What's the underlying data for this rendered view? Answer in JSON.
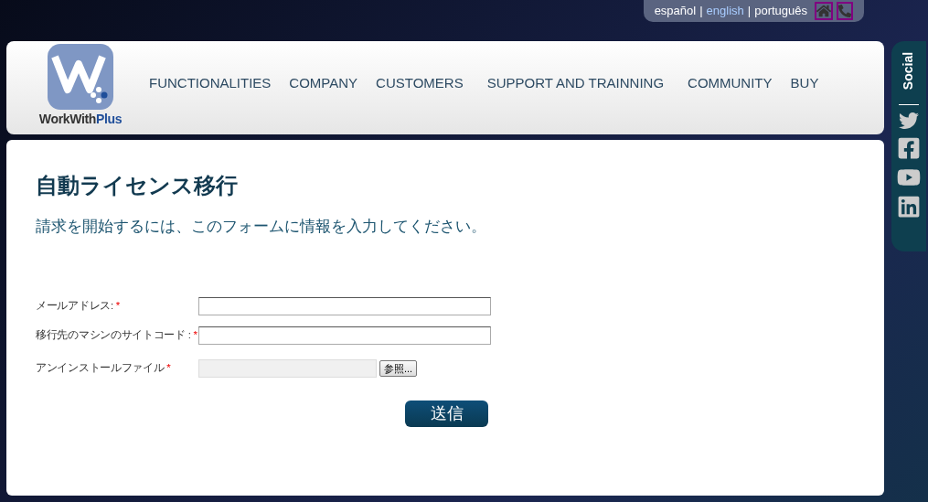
{
  "languages": [
    {
      "label": "español",
      "selected": false
    },
    {
      "label": "english",
      "selected": true
    },
    {
      "label": "português",
      "selected": false
    }
  ],
  "separator": "|",
  "logo": {
    "text_1": "WorkWith",
    "text_2": "Plus"
  },
  "nav": [
    "FUNCTIONALITIES",
    "COMPANY",
    "CUSTOMERS",
    "SUPPORT AND TRAINNING",
    "COMMUNITY",
    "BUY"
  ],
  "social": {
    "label": "Social"
  },
  "page": {
    "title": "自動ライセンス移行",
    "subtitle": "請求を開始するには、このフォームに情報を入力してください。"
  },
  "form": {
    "fields": [
      {
        "kind": "text",
        "label": "メールアドレス:",
        "required_mark": "*"
      },
      {
        "kind": "text",
        "label": "移行先のマシンのサイトコード :",
        "required_mark": "*"
      },
      {
        "kind": "file",
        "label": "アンインストールファイル",
        "required_mark": "*",
        "browse": "参照..."
      }
    ],
    "submit": "送信"
  }
}
